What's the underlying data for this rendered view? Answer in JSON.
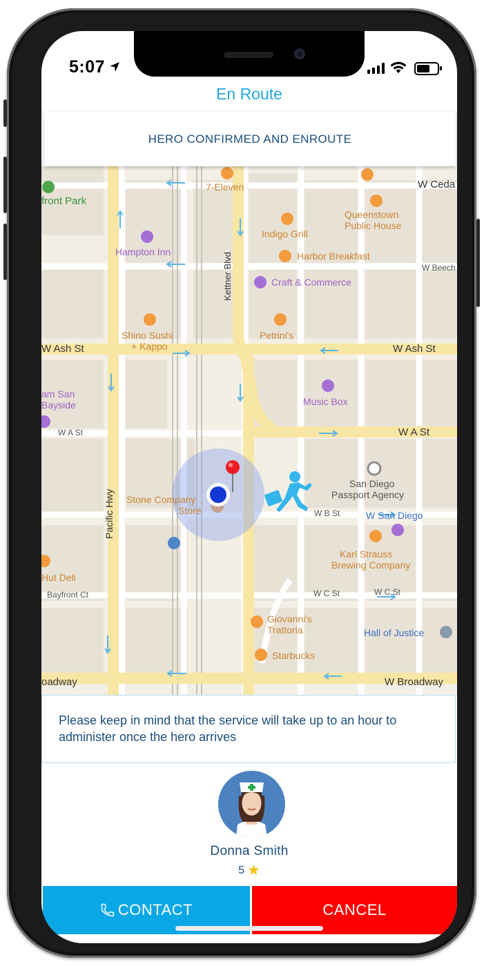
{
  "status_bar": {
    "time": "5:07"
  },
  "header": {
    "title": "En Route"
  },
  "banner": {
    "text": "HERO CONFIRMED AND ENROUTE"
  },
  "map": {
    "labels": {
      "park": "front Park",
      "seven_eleven": "7-Eleven",
      "w_cedar": "W Ceda",
      "queenstown_1": "Queenstown",
      "queenstown_2": "Public House",
      "indigo_grill": "Indigo Grill",
      "hampton_inn": "Hampton Inn",
      "harbor_breakfast": "Harbor Breakfast",
      "w_beech": "W Beech",
      "craft_commerce": "Craft & Commerce",
      "kettner": "Kettner Blvd",
      "shino_1": "Shino Sushi",
      "shino_2": "+ Kappo",
      "petrinis": "Petrini's",
      "w_ash_left": "W Ash St",
      "w_ash_right": "W Ash St",
      "sam_san_1": "am San",
      "sam_san_2": "Bayside",
      "music_box": "Music Box",
      "w_a_left": "W A St",
      "w_a_right": "W A St",
      "pacific_hwy": "Pacific Hwy",
      "stone_1": "Stone Company",
      "stone_2": "Store",
      "passport_1": "San Diego",
      "passport_2": "Passport Agency",
      "w_b_st": "W B St",
      "w_san_diego": "W San Diego",
      "karl_1": "Karl Strauss",
      "karl_2": "Brewing Company",
      "hut_deli": "Hut Deli",
      "bayfront_ct": "Bayfront Ct",
      "w_c_mid": "W C St",
      "w_c_right": "W C St",
      "giovanni_1": "Giovanni's",
      "giovanni_2": "Trattoria",
      "hall_justice": "Hall of Justice",
      "starbucks": "Starbucks",
      "broadway_left": "oadway",
      "broadway_right": "W Broadway"
    }
  },
  "notice": {
    "text": "Please keep in mind that the service will take up to an hour to administer once the hero arrives"
  },
  "hero": {
    "name": "Donna Smith",
    "rating": "5"
  },
  "actions": {
    "contact_label": "CONTACT",
    "cancel_label": "CANCEL"
  },
  "colors": {
    "accent": "#25a7de",
    "contact": "#0aa7e6",
    "cancel": "#ff0000",
    "text_dark_blue": "#1c4f7c"
  }
}
